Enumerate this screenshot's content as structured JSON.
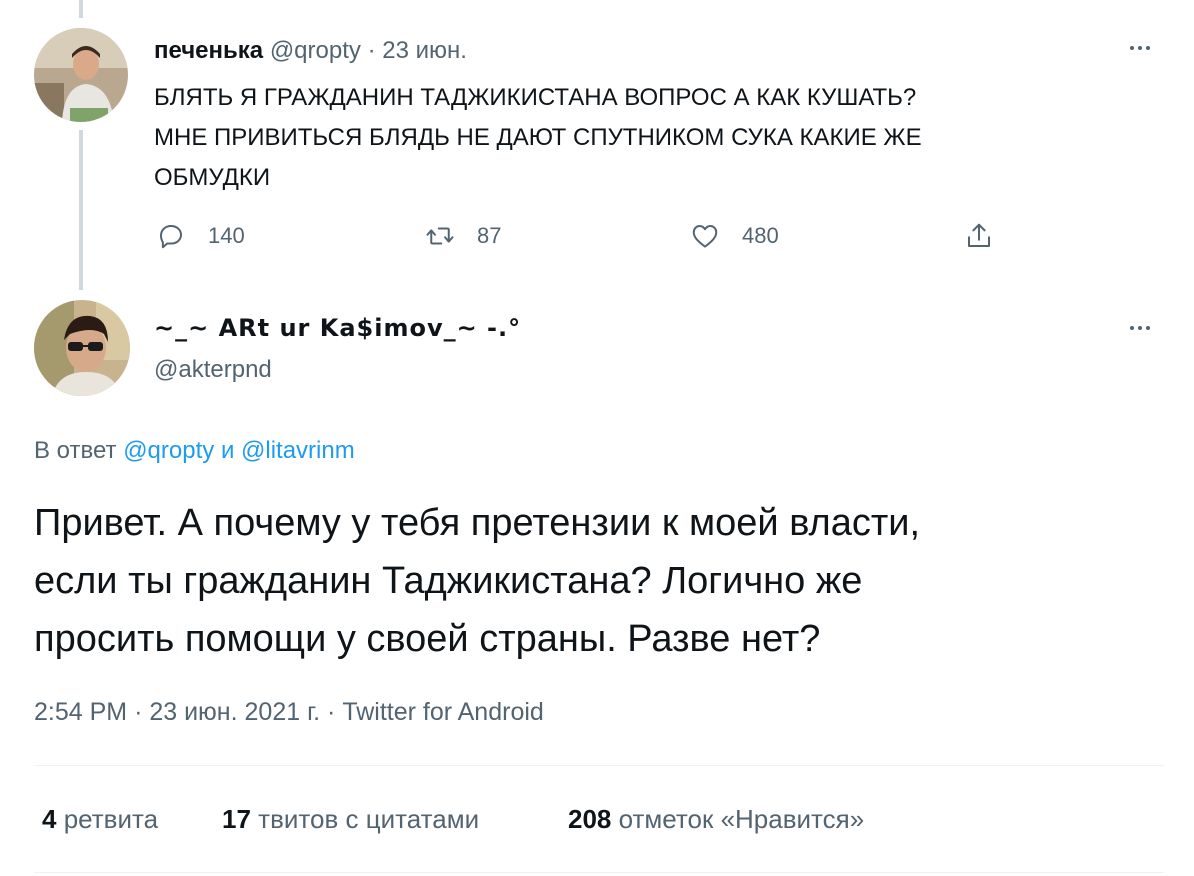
{
  "first_tweet": {
    "display_name": "печенька",
    "handle": "@qropty",
    "separator": "·",
    "date": "23 июн.",
    "text_line1": "БЛЯТЬ Я ГРАЖДАНИН ТАДЖИКИСТАНА ВОПРОС А КАК КУШАТЬ?",
    "text_line2": "МНЕ ПРИВИТЬСЯ БЛЯДЬ НЕ ДАЮТ СПУТНИКОМ СУКА КАКИЕ ЖЕ",
    "text_line3": "ОБМУДКИ",
    "actions": {
      "reply_count": "140",
      "retweet_count": "87",
      "like_count": "480"
    },
    "icons": [
      "reply-icon",
      "retweet-icon",
      "like-icon",
      "share-icon",
      "more-icon"
    ]
  },
  "main_tweet": {
    "display_name": "~_~ ARt ur Ka$imov_~ -.°",
    "handle": "@akterpnd",
    "reply_prefix": "В ответ",
    "reply_to_1": "@qropty",
    "reply_conj": "и",
    "reply_to_2": "@litavrinm",
    "text_line1": "Привет. А почему у тебя претензии к моей власти,",
    "text_line2": "если ты гражданин Таджикистана? Логично же",
    "text_line3": "просить помощи у своей страны. Разве нет?",
    "time": "2:54 PM",
    "dot1": "·",
    "date": "23 июн. 2021 г.",
    "dot2": "·",
    "source": "Twitter for Android"
  },
  "stats": {
    "retweets_count": "4",
    "retweets_label": "ретвита",
    "quotes_count": "17",
    "quotes_label": "твитов с цитатами",
    "likes_count": "208",
    "likes_label": "отметок «Нравится»"
  },
  "colors": {
    "text": "#0f1419",
    "muted": "#536471",
    "link": "#1d9bf0",
    "thread_line": "#cfd9de",
    "divider": "#eff3f4"
  }
}
